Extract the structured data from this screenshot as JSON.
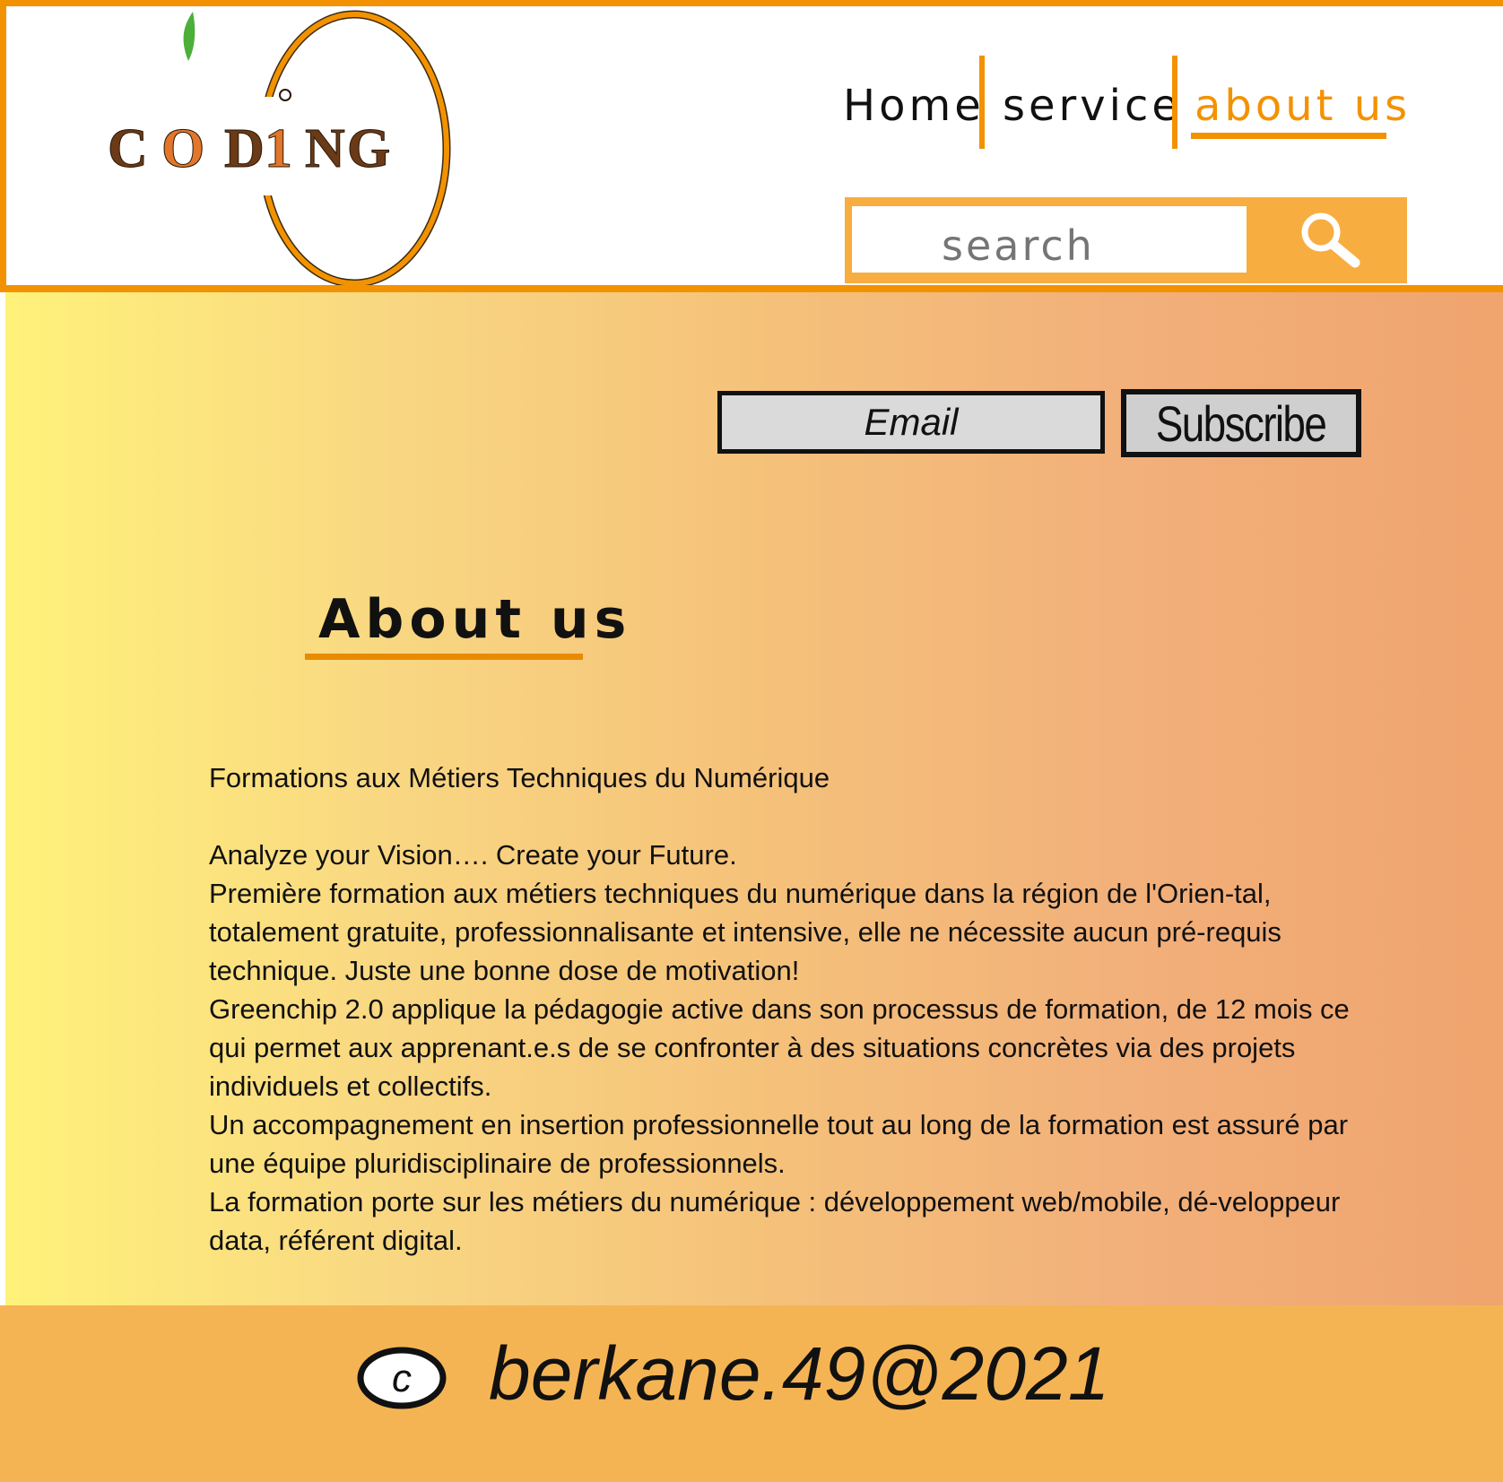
{
  "brand": {
    "logo_text": "CODING",
    "accent_color": "#f39200",
    "leaf_color": "#4caf3a"
  },
  "nav": {
    "items": [
      {
        "label": "Home",
        "active": false
      },
      {
        "label": "service",
        "active": false
      },
      {
        "label": "about us",
        "active": true
      }
    ]
  },
  "search": {
    "placeholder": "search",
    "icon": "search-icon"
  },
  "subscribe": {
    "email_placeholder": "Email",
    "button_label": "Subscribe"
  },
  "about": {
    "title": "About us",
    "subtitle": "Formations aux Métiers Techniques du Numérique",
    "paragraphs": [
      "Analyze your Vision…. Create your Future.",
      "Première formation aux métiers techniques du numérique dans la région de l'Orien-tal, totalement gratuite, professionnalisante et intensive, elle ne nécessite aucun pré-requis technique. Juste une bonne dose de motivation!",
      "Greenchip 2.0 applique la pédagogie active dans son processus de formation, de 12 mois ce qui permet aux apprenant.e.s de se confronter à des situations concrètes via des projets individuels et collectifs.",
      "Un accompagnement en insertion professionnelle tout au long de la formation est assuré par une équipe pluridisciplinaire de professionnels.",
      "La formation porte sur les métiers du numérique : développement web/mobile, dé-veloppeur data, référent digital."
    ]
  },
  "footer": {
    "copyright_icon": "copyright-icon",
    "copyright_text": "berkane.49@2021"
  }
}
